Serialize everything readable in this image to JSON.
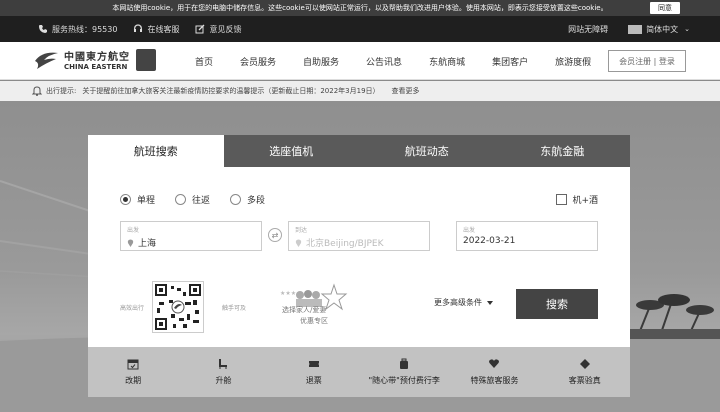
{
  "cookie": {
    "text": "本网站使用cookie，用于在您的电脑中储存信息。这些cookie可以使网站正常运行，以及帮助我们改进用户体验。使用本网站，即表示您接受放置这些cookie。",
    "agree": "同意"
  },
  "topbar": {
    "hotline": "服务热线：95530",
    "online": "在线客服",
    "feedback": "意见反馈",
    "accessible": "网站无障碍",
    "language": "简体中文"
  },
  "logo": {
    "cn": "中國東方航空",
    "en": "CHINA EASTERN"
  },
  "nav": {
    "items": [
      "首页",
      "会员服务",
      "自助服务",
      "公告讯息",
      "东航商城",
      "集团客户",
      "旅游度假"
    ],
    "login": "会员注册 | 登录"
  },
  "notice": {
    "label": "出行提示:",
    "text": "关于提醒前往加拿大旅客关注最新疫情防控要求的温馨提示（更新截止日期：2022年3月19日）",
    "more": "查看更多"
  },
  "tabs": [
    "航班搜索",
    "选座值机",
    "航班动态",
    "东航金融"
  ],
  "trip": {
    "options": [
      "单程",
      "往返",
      "多段"
    ],
    "selected": 0,
    "hotel": "机+酒"
  },
  "form": {
    "from_label": "出发",
    "from_value": "上海",
    "to_label": "到达",
    "to_placeholder": "北京Beijing/BJPEK",
    "date_label": "出发",
    "date_value": "2022-03-21",
    "advanced": "更多高级条件",
    "search": "搜索"
  },
  "qr": {
    "left": "高效出行",
    "right": "触手可及"
  },
  "promo": {
    "line1": "选择家人/爱妻",
    "line2": "优惠专区"
  },
  "quick": [
    "改期",
    "升舱",
    "退票",
    "\"随心带\"预付费行李",
    "特殊旅客服务",
    "客票验真"
  ]
}
